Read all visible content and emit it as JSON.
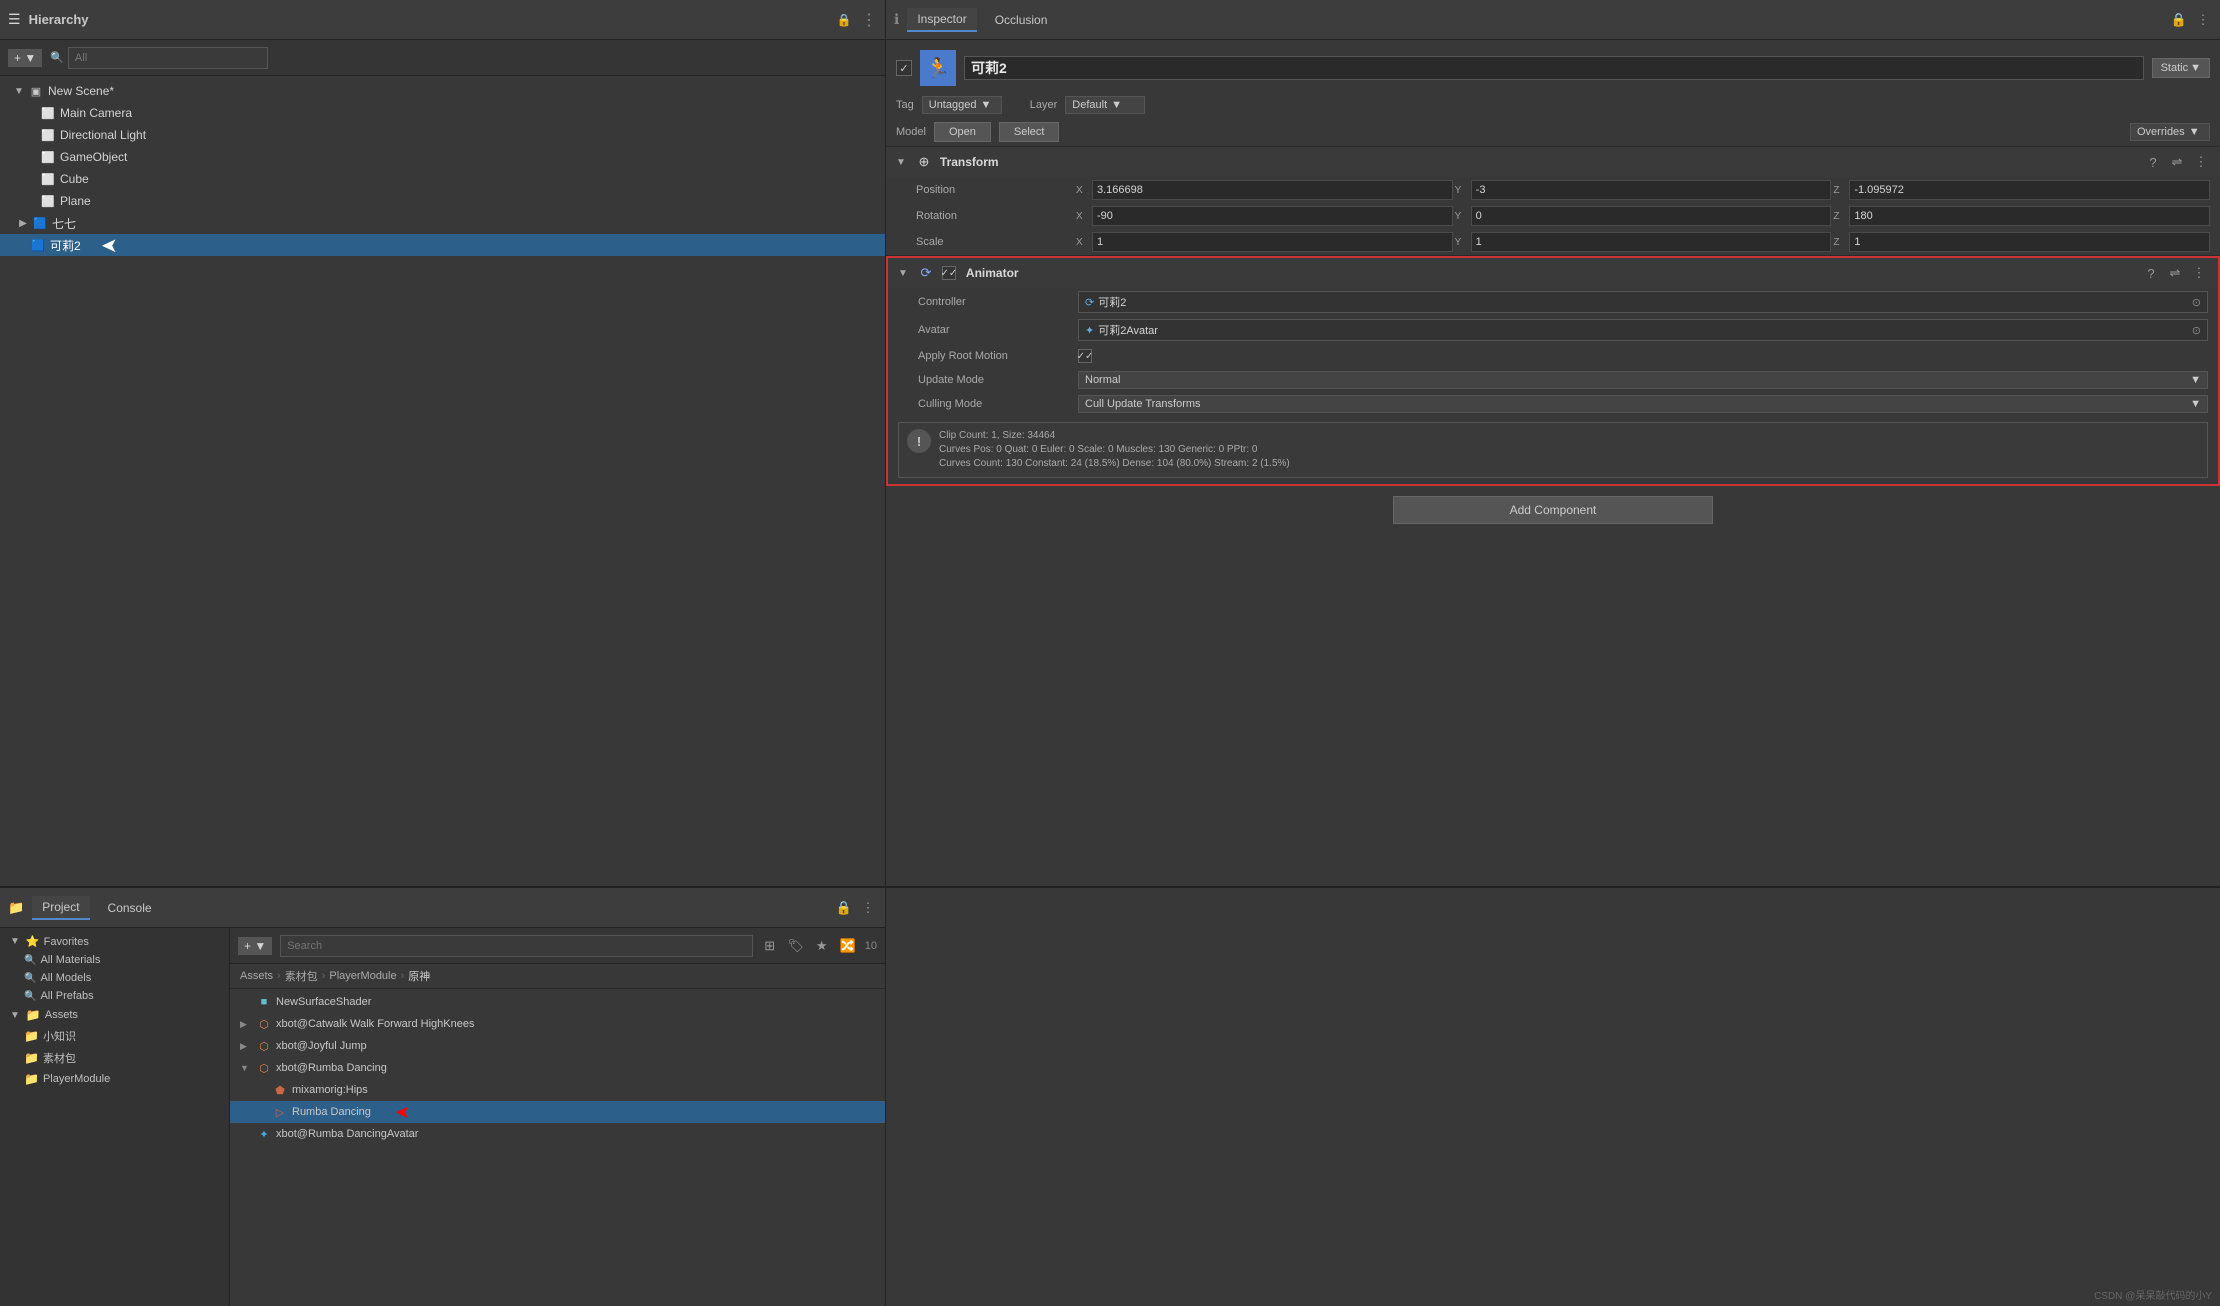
{
  "hierarchy": {
    "title": "Hierarchy",
    "search_placeholder": "All",
    "scene": "New Scene*",
    "items": [
      {
        "id": "main-camera",
        "label": "Main Camera",
        "indent": 1,
        "icon": "cube",
        "expanded": false
      },
      {
        "id": "directional-light",
        "label": "Directional Light",
        "indent": 1,
        "icon": "cube",
        "expanded": false
      },
      {
        "id": "gameobject",
        "label": "GameObject",
        "indent": 1,
        "icon": "cube",
        "expanded": false
      },
      {
        "id": "cube",
        "label": "Cube",
        "indent": 1,
        "icon": "cube",
        "expanded": false
      },
      {
        "id": "plane",
        "label": "Plane",
        "indent": 1,
        "icon": "cube",
        "expanded": false
      },
      {
        "id": "qiqi",
        "label": "七七",
        "indent": 1,
        "icon": "char",
        "expanded": false
      },
      {
        "id": "keli2",
        "label": "可莉2",
        "indent": 1,
        "icon": "char",
        "expanded": false,
        "selected": true
      }
    ]
  },
  "inspector": {
    "title": "Inspector",
    "occlusion_tab": "Occlusion",
    "object_name": "可莉2",
    "static_label": "Static",
    "tag_label": "Tag",
    "tag_value": "Untagged",
    "layer_label": "Layer",
    "layer_value": "Default",
    "model_label": "Model",
    "model_open": "Open",
    "model_select": "Select",
    "model_overrides": "Overrides",
    "transform": {
      "title": "Transform",
      "position_label": "Position",
      "pos_x": "3.166698",
      "pos_y": "-3",
      "pos_z": "-1.095972",
      "rotation_label": "Rotation",
      "rot_x": "-90",
      "rot_y": "0",
      "rot_z": "180",
      "scale_label": "Scale",
      "scale_x": "1",
      "scale_y": "1",
      "scale_z": "1"
    },
    "animator": {
      "title": "Animator",
      "controller_label": "Controller",
      "controller_value": "可莉2",
      "avatar_label": "Avatar",
      "avatar_value": "可莉2Avatar",
      "apply_root_motion_label": "Apply Root Motion",
      "update_mode_label": "Update Mode",
      "update_mode_value": "Normal",
      "culling_mode_label": "Culling Mode",
      "culling_mode_value": "Cull Update Transforms",
      "info_text": "Clip Count: 1, Size: 34464\nCurves Pos: 0 Quat: 0 Euler: 0 Scale: 0 Muscles: 130 Generic: 0 PPtr: 0\nCurves Count: 130 Constant: 24 (18.5%) Dense: 104 (80.0%) Stream: 2 (1.5%)"
    },
    "add_component_label": "Add Component"
  },
  "project": {
    "title": "Project",
    "console_tab": "Console",
    "breadcrumb": [
      "Assets",
      "素材包",
      "PlayerModule",
      "原神"
    ],
    "sidebar": {
      "favorites_label": "Favorites",
      "items": [
        {
          "label": "All Materials",
          "icon": "search"
        },
        {
          "label": "All Models",
          "icon": "search"
        },
        {
          "label": "All Prefabs",
          "icon": "search"
        }
      ],
      "assets_label": "Assets",
      "asset_items": [
        {
          "label": "小知识",
          "icon": "folder"
        },
        {
          "label": "素材包",
          "icon": "folder"
        },
        {
          "label": "PlayerModule",
          "icon": "folder"
        }
      ]
    },
    "files": [
      {
        "label": "NewSurfaceShader",
        "icon": "shader",
        "indent": 0
      },
      {
        "label": "xbot@Catwalk Walk Forward HighKnees",
        "icon": "anim",
        "indent": 0
      },
      {
        "label": "xbot@Joyful Jump",
        "icon": "anim",
        "indent": 0
      },
      {
        "label": "xbot@Rumba Dancing",
        "icon": "anim",
        "indent": 0,
        "expanded": true
      },
      {
        "label": "mixamorig:Hips",
        "icon": "anim-sub",
        "indent": 1
      },
      {
        "label": "Rumba Dancing",
        "icon": "anim-clip",
        "indent": 1,
        "selected": true
      },
      {
        "label": "xbot@Rumba DancingAvatar",
        "icon": "avatar",
        "indent": 0
      }
    ]
  },
  "watermark": "CSDN @呆呆敲代码的小Y"
}
